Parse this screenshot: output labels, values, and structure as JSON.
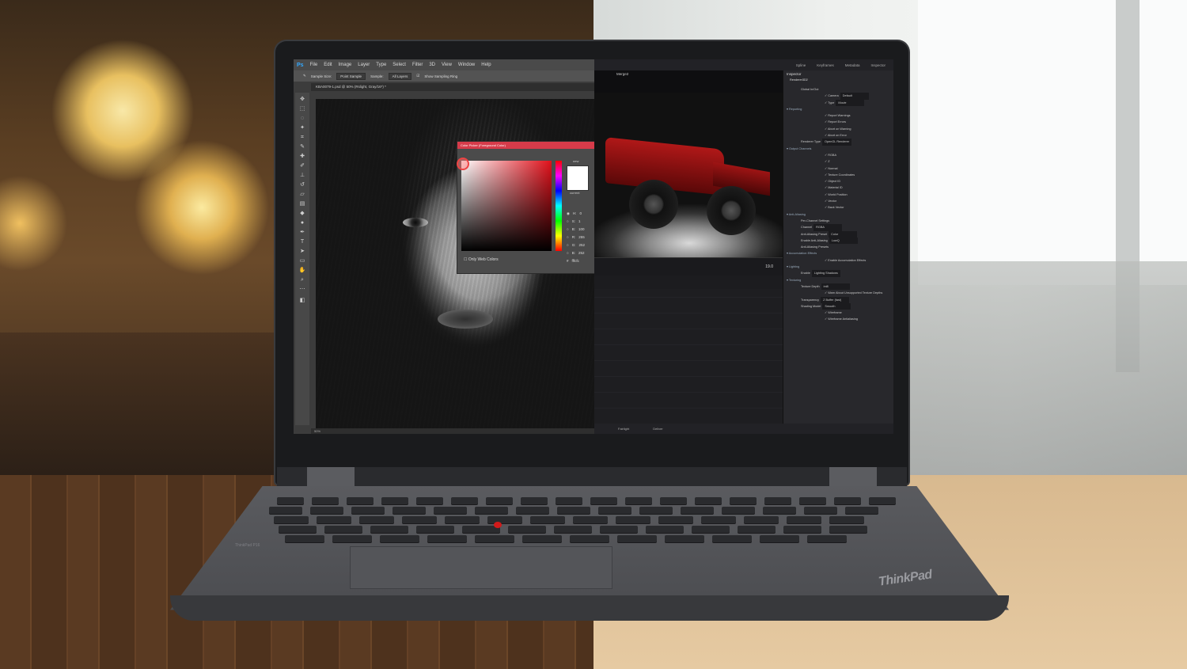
{
  "photoshop": {
    "menu": [
      "File",
      "Edit",
      "Image",
      "Layer",
      "Type",
      "Select",
      "Filter",
      "3D",
      "View",
      "Window",
      "Help"
    ],
    "options": {
      "sample_size_label": "Sample Size:",
      "sample_size_value": "Point Sample",
      "sample_label": "Sample:",
      "sample_value": "All Layers",
      "show_ring": "Show Sampling Ring"
    },
    "document_tab": "KBA0079-1.psd @ 50% (Rslight, Gray/16*) *",
    "status": "50%",
    "color_picker": {
      "title": "Color Picker (Foreground Color)",
      "new_label": "new",
      "current_label": "current",
      "fields": [
        {
          "label": "H:",
          "value": "0"
        },
        {
          "label": "S:",
          "value": "1"
        },
        {
          "label": "B:",
          "value": "100"
        },
        {
          "label": "R:",
          "value": "255"
        },
        {
          "label": "G:",
          "value": "252"
        },
        {
          "label": "B:",
          "value": "252"
        }
      ],
      "hex_value": "fffcfc",
      "only_web_colors": "Only Web Colors"
    }
  },
  "davinci": {
    "top_tabs": [
      "Spline",
      "Keyframes",
      "Metadata",
      "Inspector"
    ],
    "viewer_title": "Merge2",
    "timecode": "19.0",
    "bottom_tabs": [
      "Fairlight",
      "Deliver"
    ],
    "inspector": {
      "title": "Inspector",
      "node_name": "Renderer3D2",
      "rows": [
        {
          "t": "f",
          "label": "Global In/Out"
        },
        {
          "t": "c",
          "label": "Camera",
          "value": "Default"
        },
        {
          "t": "c",
          "label": "Type",
          "value": "Movie"
        },
        {
          "t": "h",
          "label": "Reporting"
        },
        {
          "t": "c",
          "label": "Report Warnings"
        },
        {
          "t": "c",
          "label": "Report Errors"
        },
        {
          "t": "c",
          "label": "Abort on Warning"
        },
        {
          "t": "c",
          "label": "Abort on Error"
        },
        {
          "t": "f",
          "label": "Renderer Type",
          "value": "OpenGL Renderer"
        },
        {
          "t": "h",
          "label": "Output Channels"
        },
        {
          "t": "c",
          "label": "RGBA"
        },
        {
          "t": "c",
          "label": "Z"
        },
        {
          "t": "c",
          "label": "Normal"
        },
        {
          "t": "c",
          "label": "Texture Coordinates"
        },
        {
          "t": "c",
          "label": "Object ID"
        },
        {
          "t": "c",
          "label": "Material ID"
        },
        {
          "t": "c",
          "label": "World Position"
        },
        {
          "t": "c",
          "label": "Vector"
        },
        {
          "t": "c",
          "label": "Back Vector"
        },
        {
          "t": "h",
          "label": "Anti-Aliasing"
        },
        {
          "t": "f",
          "label": "Per-Channel Settings"
        },
        {
          "t": "f",
          "label": "Channel",
          "value": "RGBA"
        },
        {
          "t": "f",
          "label": "Anti-Aliasing Preset",
          "value": "Color"
        },
        {
          "t": "f",
          "label": "Enable Anti-Aliasing",
          "value": "LowQ"
        },
        {
          "t": "f",
          "label": "Anti-Aliasing Presets"
        },
        {
          "t": "h",
          "label": "Accumulation Effects"
        },
        {
          "t": "c",
          "label": "Enable Accumulation Effects"
        },
        {
          "t": "h",
          "label": "Lighting"
        },
        {
          "t": "f",
          "label": "Enable",
          "value": "Lighting   Shadows"
        },
        {
          "t": "h",
          "label": "Texturing"
        },
        {
          "t": "f",
          "label": "Texture Depth",
          "value": "int8"
        },
        {
          "t": "c",
          "label": "Warn About Unsupported Texture Depths"
        },
        {
          "t": "f",
          "label": "Transparency",
          "value": "Z Buffer (fast)"
        },
        {
          "t": "f",
          "label": "Shading Model",
          "value": "Smooth"
        },
        {
          "t": "c",
          "label": "Wireframe"
        },
        {
          "t": "c",
          "label": "Wireframe Antialiasing"
        }
      ]
    }
  },
  "laptop": {
    "brand": "ThinkPad",
    "model_label": "ThinkPad P16"
  },
  "colors": {
    "trackpoint": "#d11a1a",
    "ps_accent": "#31a8ff",
    "picker_title": "#d63b4a",
    "jeep_red": "#b01818"
  }
}
